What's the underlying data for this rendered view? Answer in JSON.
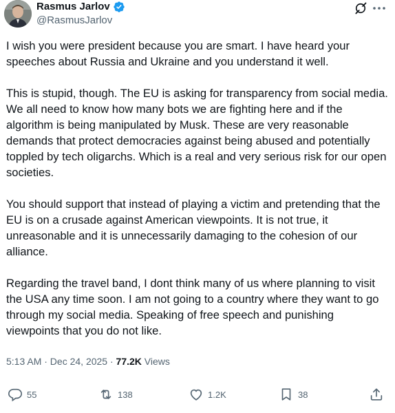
{
  "author": {
    "name": "Rasmus Jarlov",
    "handle": "@RasmusJarlov",
    "verified_color": "#1d9bf0"
  },
  "post": {
    "paragraphs": [
      "I wish you were president because you are smart. I have heard your speeches about Russia and Ukraine and you understand it well.",
      "This is stupid, though. The EU is asking for transparency from social media. We all need to know how many bots we are fighting here and if the algorithm is being manipulated by Musk. These are very reasonable demands that protect democracies against being abused and potentially toppled by tech oligarchs. Which is a real and very serious risk for our open societies.",
      "You should support that instead of playing a victim and pretending that the EU is on a crusade against American viewpoints. It is not true, it unreasonable and it is unnecessarily damaging to the cohesion of our alliance.",
      "Regarding the travel band, I dont think many of us where planning to visit the USA any time soon. I am not going to a country where they want to go through my social media. Speaking of free speech and punishing viewpoints that you do not like."
    ],
    "timestamp": "5:13 AM · Dec 24, 2025 · ",
    "views_count": "77.2K",
    "views_label": " Views"
  },
  "actions": {
    "replies": "55",
    "reposts": "138",
    "likes": "1.2K",
    "bookmarks": "38"
  },
  "icons": {
    "header_right": [
      "grok-icon",
      "more-icon"
    ],
    "action_bar": [
      "reply-icon",
      "repost-icon",
      "like-icon",
      "bookmark-icon",
      "share-icon"
    ]
  }
}
